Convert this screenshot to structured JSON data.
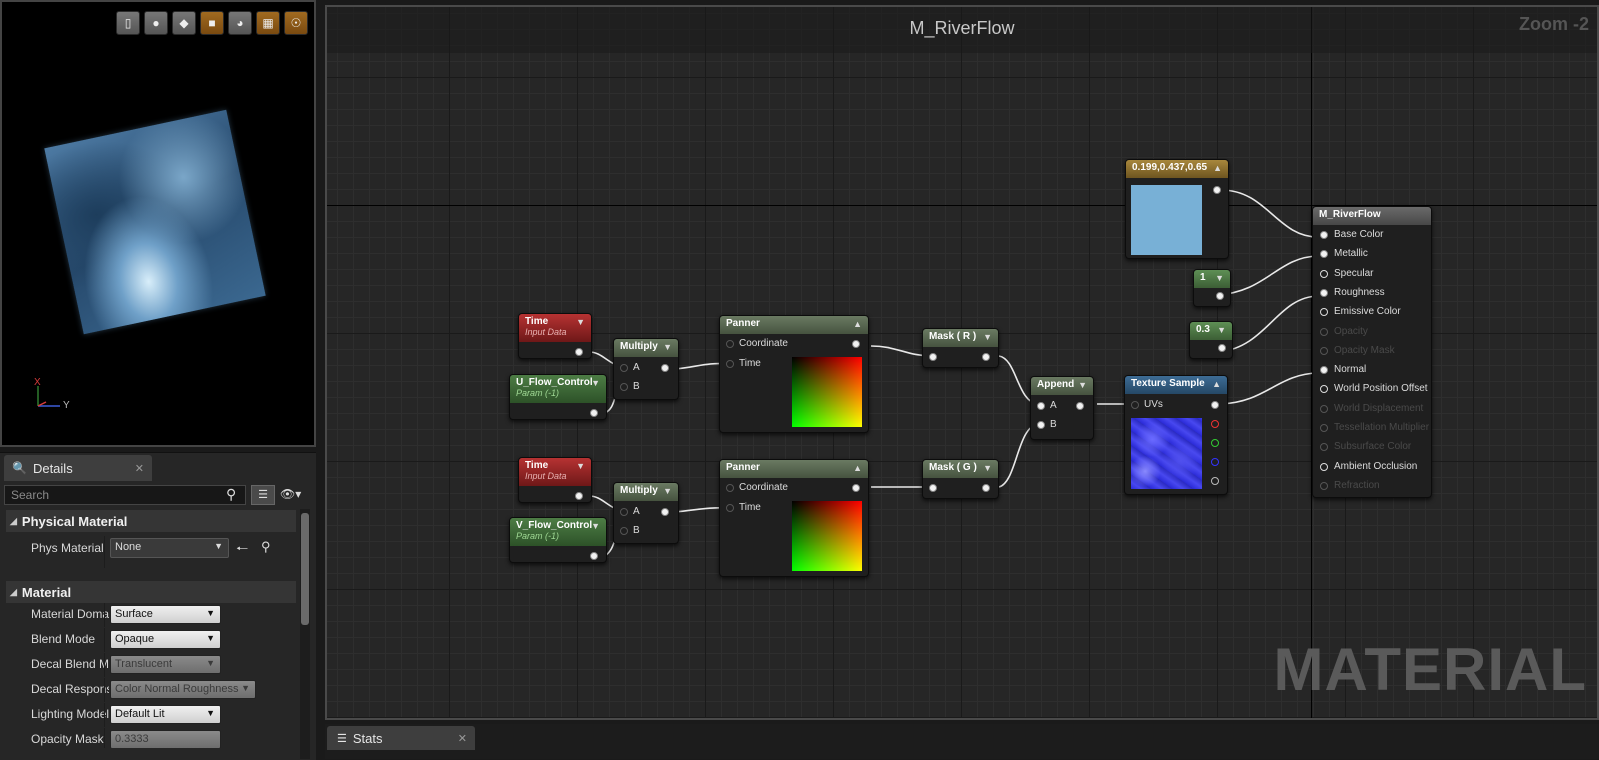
{
  "viewport": {
    "tools": [
      "box-icon",
      "sphere-icon",
      "plane-icon",
      "cube-icon",
      "teapot-icon",
      "grid-icon",
      "realtime-icon"
    ],
    "axis_x": "X",
    "axis_y": "Y"
  },
  "details": {
    "tab_label": "Details",
    "search_placeholder": "Search",
    "sections": {
      "physical_material": {
        "title": "Physical Material",
        "phys_material_label": "Phys Material",
        "phys_material_value": "None"
      },
      "material": {
        "title": "Material",
        "rows": [
          {
            "label": "Material Doma",
            "value": "Surface"
          },
          {
            "label": "Blend Mode",
            "value": "Opaque"
          },
          {
            "label": "Decal Blend M",
            "value": "Translucent"
          },
          {
            "label": "Decal Respons",
            "value": "Color Normal Roughness"
          },
          {
            "label": "Lighting Model",
            "value": "Default Lit"
          },
          {
            "label": "Opacity Mask",
            "value": "0.3333"
          }
        ]
      }
    }
  },
  "graph": {
    "title": "M_RiverFlow",
    "zoom": "Zoom -2",
    "watermark": "MATERIAL",
    "nodes": {
      "time1": {
        "title": "Time",
        "subtitle": "Input Data"
      },
      "time2": {
        "title": "Time",
        "subtitle": "Input Data"
      },
      "u_flow": {
        "title": "U_Flow_Control",
        "subtitle": "Param (-1)"
      },
      "v_flow": {
        "title": "V_Flow_Control",
        "subtitle": "Param (-1)"
      },
      "multiply1": {
        "title": "Multiply",
        "pin_a": "A",
        "pin_b": "B"
      },
      "multiply2": {
        "title": "Multiply",
        "pin_a": "A",
        "pin_b": "B"
      },
      "panner1": {
        "title": "Panner",
        "pin_coord": "Coordinate",
        "pin_time": "Time"
      },
      "panner2": {
        "title": "Panner",
        "pin_coord": "Coordinate",
        "pin_time": "Time"
      },
      "mask_r": {
        "title": "Mask ( R )"
      },
      "mask_g": {
        "title": "Mask ( G )"
      },
      "append": {
        "title": "Append",
        "pin_a": "A",
        "pin_b": "B"
      },
      "texture": {
        "title": "Texture Sample",
        "pin_uvs": "UVs"
      },
      "color_const": {
        "title": "0.199,0.437,0.65",
        "swatch_color": "#78b0d6"
      },
      "const_1": {
        "title": "1"
      },
      "const_03": {
        "title": "0.3"
      },
      "root": {
        "title": "M_RiverFlow",
        "inputs": [
          {
            "label": "Base Color",
            "state": "connected"
          },
          {
            "label": "Metallic",
            "state": "connected"
          },
          {
            "label": "Specular",
            "state": "open"
          },
          {
            "label": "Roughness",
            "state": "connected"
          },
          {
            "label": "Emissive Color",
            "state": "open"
          },
          {
            "label": "Opacity",
            "state": "disabled"
          },
          {
            "label": "Opacity Mask",
            "state": "disabled"
          },
          {
            "label": "Normal",
            "state": "connected"
          },
          {
            "label": "World Position Offset",
            "state": "open"
          },
          {
            "label": "World Displacement",
            "state": "disabled"
          },
          {
            "label": "Tessellation Multiplier",
            "state": "disabled"
          },
          {
            "label": "Subsurface Color",
            "state": "disabled"
          },
          {
            "label": "Ambient Occlusion",
            "state": "open"
          },
          {
            "label": "Refraction",
            "state": "disabled"
          }
        ]
      }
    }
  },
  "stats": {
    "tab_label": "Stats"
  },
  "colors": {
    "accent_orange": "#d08a1a",
    "time_red": "#b63232",
    "param_green": "#4d7d45"
  }
}
